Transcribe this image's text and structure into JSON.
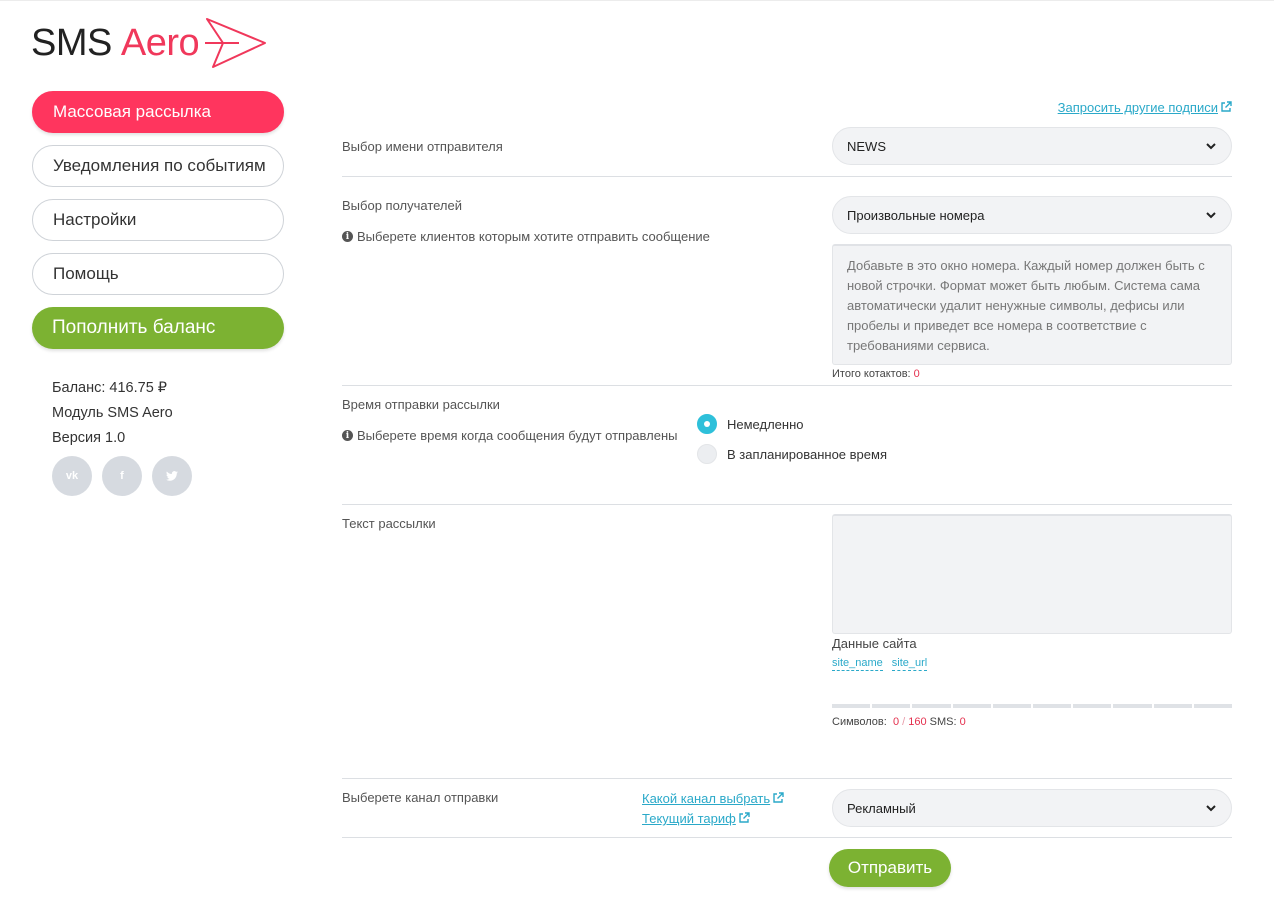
{
  "brand": {
    "name_part1": "SMS",
    "name_part2": "Aero",
    "accent": "#ff355e",
    "green": "#7cb232",
    "link": "#2aa9c9"
  },
  "sidebar": {
    "items": [
      {
        "label": "Массовая рассылка",
        "active": true
      },
      {
        "label": "Уведомления по событиям"
      },
      {
        "label": "Настройки"
      },
      {
        "label": "Помощь"
      }
    ],
    "topup_label": "Пополнить баланс",
    "balance": "Баланс: 416.75 ₽",
    "module": "Модуль SMS Aero",
    "version": "Версия 1.0",
    "social": [
      {
        "icon": "vk-icon",
        "glyph": "vk"
      },
      {
        "icon": "facebook-icon",
        "glyph": "f"
      },
      {
        "icon": "twitter-icon",
        "glyph": "🐦"
      }
    ]
  },
  "form": {
    "request_link": "Запросить другие подписи",
    "sender": {
      "label": "Выбор имени отправителя",
      "value": "NEWS"
    },
    "recipients": {
      "label": "Выбор получателей",
      "hint": "Выберете клиентов которым хотите отправить сообщение",
      "value": "Произвольные номера",
      "numbers_placeholder": "Добавьте в это окно номера. Каждый номер должен быть с новой строчки. Формат может быть любым. Система сама автоматически удалит ненужные символы, дефисы или пробелы и приведет все номера в соответствие с требованиями сервиса.",
      "total_label": "Итого котактов:",
      "total_value": "0"
    },
    "send_time": {
      "label": "Время отправки рассылки",
      "hint": "Выберете время когда сообщения будут отправлены",
      "options": [
        {
          "label": "Немедленно",
          "selected": true
        },
        {
          "label": "В запланированное время",
          "selected": false
        }
      ]
    },
    "text": {
      "label": "Текст рассылки",
      "value": "",
      "site_data_label": "Данные сайта",
      "tags": [
        "site_name",
        "site_url"
      ],
      "chars_label": "Символов:",
      "chars_value": "0",
      "chars_sep": "/",
      "chars_max": "160",
      "sms_label": "SMS:",
      "sms_value": "0"
    },
    "channel": {
      "label": "Выберете канал отправки",
      "link_which": "Какой канал выбрать",
      "link_tariff": "Текущий тариф",
      "value": "Рекламный"
    },
    "submit_label": "Отправить"
  }
}
